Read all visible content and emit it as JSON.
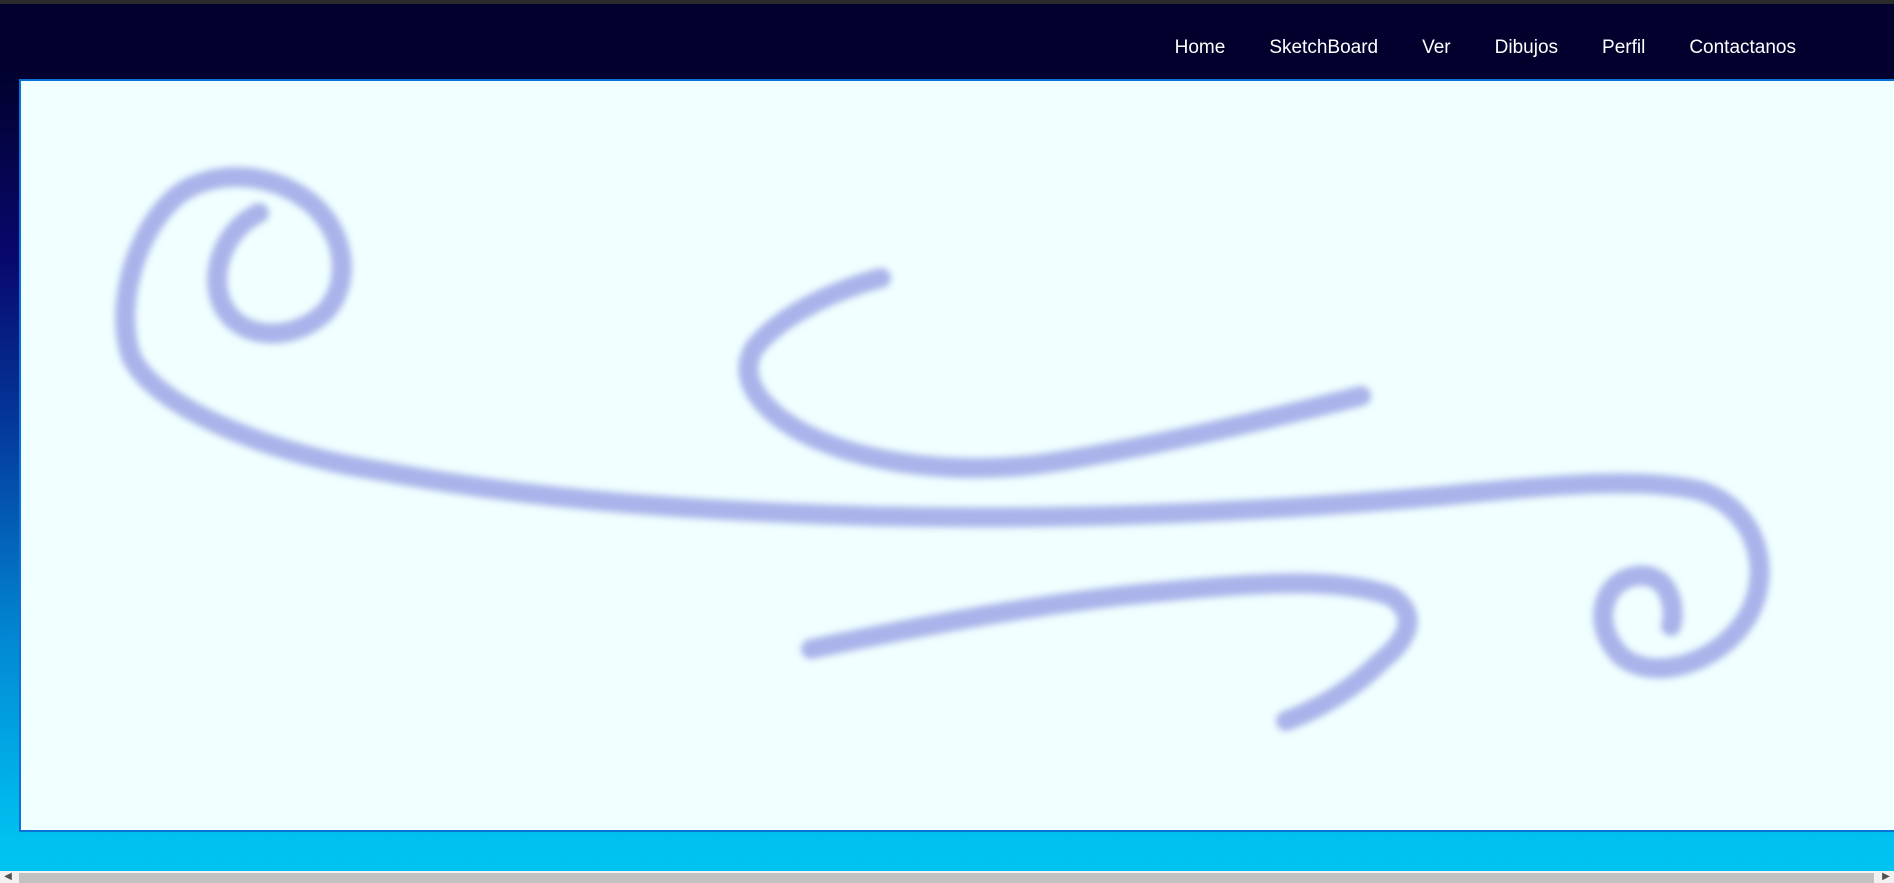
{
  "nav": {
    "items": [
      {
        "label": "Home"
      },
      {
        "label": "SketchBoard"
      },
      {
        "label": "Ver"
      },
      {
        "label": "Dibujos"
      },
      {
        "label": "Perfil"
      },
      {
        "label": "Contactanos"
      }
    ]
  },
  "sketch": {
    "stroke_color": "#aab4ea",
    "background_color": "#f0ffff",
    "border_color": "#0b73d6"
  },
  "scrollbar": {
    "left_arrow_icon": "chevron-left-icon",
    "right_arrow_icon": "chevron-right-icon"
  }
}
